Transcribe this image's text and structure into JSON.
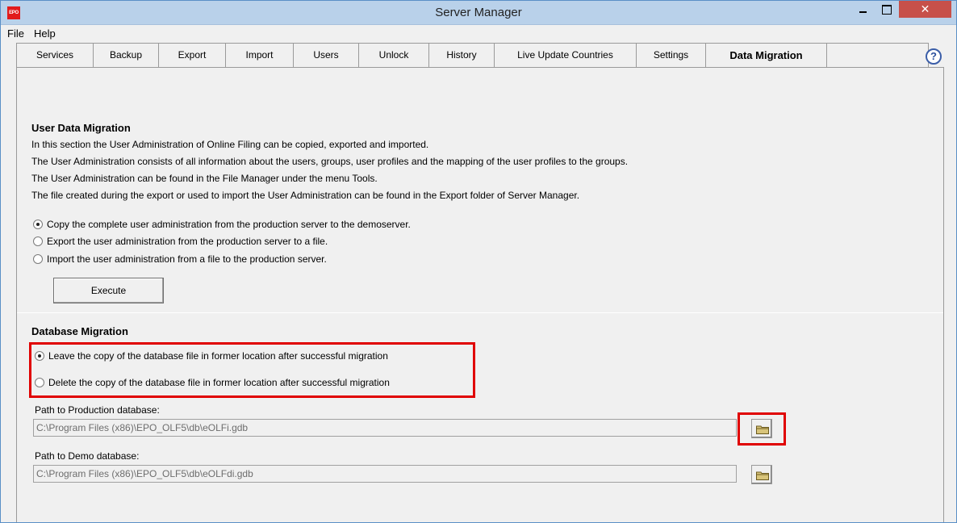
{
  "window": {
    "title": "Server Manager",
    "app_icon_text": "EPO",
    "close_glyph": "✕"
  },
  "menu": {
    "file": "File",
    "help": "Help"
  },
  "tabs": [
    {
      "label": "Services"
    },
    {
      "label": "Backup"
    },
    {
      "label": "Export"
    },
    {
      "label": "Import"
    },
    {
      "label": "Users"
    },
    {
      "label": "Unlock"
    },
    {
      "label": "History"
    },
    {
      "label": "Live Update Countries"
    },
    {
      "label": "Settings"
    },
    {
      "label": "Data Migration",
      "active": true
    },
    {
      "label": ""
    }
  ],
  "help_glyph": "?",
  "user_data_migration": {
    "title": "User Data Migration",
    "lines": [
      "In this section the User Administration of Online Filing can be copied, exported and imported.",
      "The User Administration consists of all information about the users, groups, user profiles and the mapping of the user profiles to the groups.",
      "The User Administration can be found in the File Manager under the menu Tools.",
      "The file created during the export or used to import the User Administration can be found in the Export folder of Server Manager."
    ],
    "options": [
      {
        "label": "Copy the complete user administration from the production server to the demoserver.",
        "checked": true
      },
      {
        "label": "Export the user administration from the production server to a file.",
        "checked": false
      },
      {
        "label": "Import the user administration from a file to the production server.",
        "checked": false
      }
    ],
    "execute_label": "Execute"
  },
  "database_migration": {
    "title": "Database Migration",
    "options": [
      {
        "label": "Leave the copy of the database file in former location after successful migration",
        "checked": true
      },
      {
        "label": "Delete the copy of the database file in former location after successful migration",
        "checked": false
      }
    ],
    "production_label": "Path to Production database:",
    "production_path": "C:\\Program Files (x86)\\EPO_OLF5\\db\\eOLFi.gdb",
    "demo_label": "Path to Demo database:",
    "demo_path": "C:\\Program Files (x86)\\EPO_OLF5\\db\\eOLFdi.gdb"
  },
  "colors": {
    "highlight": "#e00000",
    "titlebar": "#b9d1ea",
    "close": "#c7504a"
  }
}
